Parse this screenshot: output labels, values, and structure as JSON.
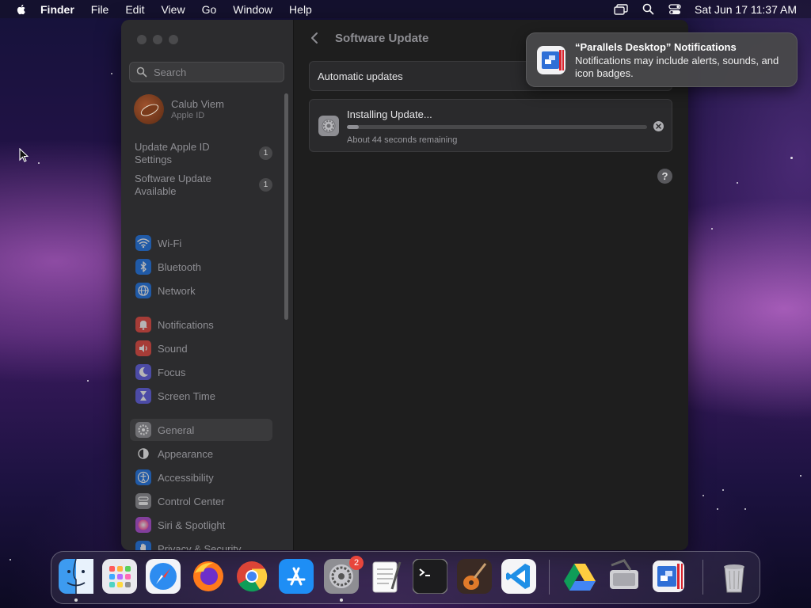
{
  "menubar": {
    "app_name": "Finder",
    "items": [
      "File",
      "Edit",
      "View",
      "Go",
      "Window",
      "Help"
    ],
    "clock": "Sat Jun 17  11:37 AM",
    "status_icons": [
      "screen-mirroring-icon",
      "spotlight-search-icon",
      "control-center-icon"
    ]
  },
  "sidebar": {
    "search_placeholder": "Search",
    "account": {
      "name": "Calub Viem",
      "subtitle": "Apple ID"
    },
    "alerts": [
      {
        "label": "Update Apple ID Settings",
        "badge": "1"
      },
      {
        "label": "Software Update Available",
        "badge": "1"
      }
    ],
    "items": [
      {
        "label": "Wi-Fi",
        "icon": "wifi-icon",
        "color": "#1a73e8"
      },
      {
        "label": "Bluetooth",
        "icon": "bluetooth-icon",
        "color": "#1a73e8"
      },
      {
        "label": "Network",
        "icon": "globe-icon",
        "color": "#1a73e8"
      },
      {
        "label": "Notifications",
        "icon": "bell-icon",
        "color": "#e8463c"
      },
      {
        "label": "Sound",
        "icon": "speaker-icon",
        "color": "#e8463c"
      },
      {
        "label": "Focus",
        "icon": "moon-icon",
        "color": "#5e5ce6"
      },
      {
        "label": "Screen Time",
        "icon": "hourglass-icon",
        "color": "#5e5ce6"
      },
      {
        "label": "General",
        "icon": "gear-icon",
        "color": "#8e8e93",
        "selected": true
      },
      {
        "label": "Appearance",
        "icon": "appearance-icon",
        "color": "#2c2c2e"
      },
      {
        "label": "Accessibility",
        "icon": "accessibility-icon",
        "color": "#1a73e8"
      },
      {
        "label": "Control Center",
        "icon": "control-center-icon",
        "color": "#8e8e93"
      },
      {
        "label": "Siri & Spotlight",
        "icon": "siri-icon",
        "color": "#b04ad8"
      },
      {
        "label": "Privacy & Security",
        "icon": "hand-icon",
        "color": "#1a73e8"
      }
    ]
  },
  "main": {
    "title": "Software Update",
    "automatic_updates_label": "Automatic updates",
    "update": {
      "heading": "Installing Update...",
      "progress": 0.04,
      "remaining": "About 44 seconds remaining"
    },
    "help_label": "?"
  },
  "notification": {
    "title": "“Parallels Desktop” Notifications",
    "body": "Notifications may include alerts, sounds, and icon badges."
  },
  "dock": {
    "apps": [
      {
        "name": "Finder",
        "icon": "finder-icon",
        "running": true
      },
      {
        "name": "Launchpad",
        "icon": "launchpad-icon"
      },
      {
        "name": "Safari",
        "icon": "safari-icon"
      },
      {
        "name": "Firefox",
        "icon": "firefox-icon"
      },
      {
        "name": "Google Chrome",
        "icon": "chrome-icon"
      },
      {
        "name": "App Store",
        "icon": "app-store-icon"
      },
      {
        "name": "System Settings",
        "icon": "settings-icon",
        "badge": "2",
        "running": true
      },
      {
        "name": "TextEdit",
        "icon": "textedit-icon"
      },
      {
        "name": "Terminal",
        "icon": "terminal-icon"
      },
      {
        "name": "GarageBand",
        "icon": "garageband-icon"
      },
      {
        "name": "Visual Studio Code",
        "icon": "vscode-icon"
      },
      {
        "name": "Google Drive",
        "icon": "google-drive-icon"
      },
      {
        "name": "Disk Utility",
        "icon": "disk-utility-icon"
      },
      {
        "name": "Parallels Desktop",
        "icon": "parallels-icon"
      },
      {
        "name": "Trash",
        "icon": "trash-icon"
      }
    ]
  }
}
